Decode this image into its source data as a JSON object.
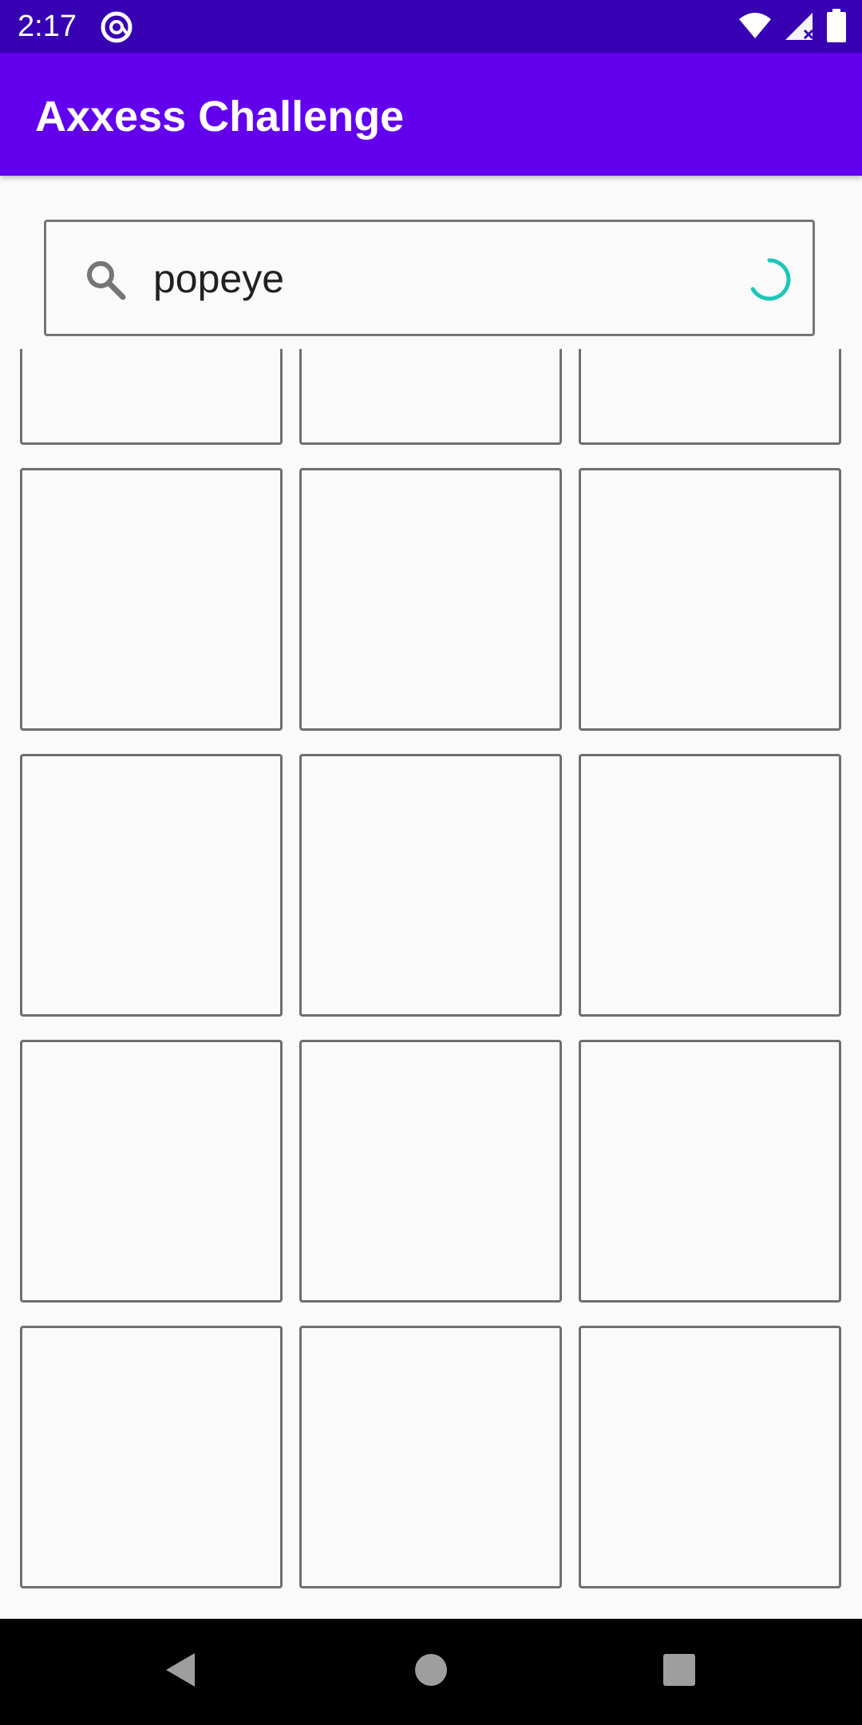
{
  "status_bar": {
    "time": "2:17",
    "app_icon": "at-sign-icon",
    "icons": [
      "wifi-icon",
      "cell-signal-icon",
      "battery-icon"
    ],
    "background": "#3700b3"
  },
  "app_bar": {
    "title": "Axxess Challenge",
    "background": "#6200ee"
  },
  "search": {
    "value": "popeye",
    "icon": "search-icon",
    "loading": true,
    "spinner_color": "#1cc7b8"
  },
  "results": {
    "tiles": [
      {},
      {},
      {},
      {},
      {},
      {},
      {},
      {},
      {},
      {},
      {},
      {},
      {},
      {},
      {}
    ]
  },
  "navigation": {
    "buttons": [
      "back-icon",
      "home-icon",
      "recents-icon"
    ]
  }
}
